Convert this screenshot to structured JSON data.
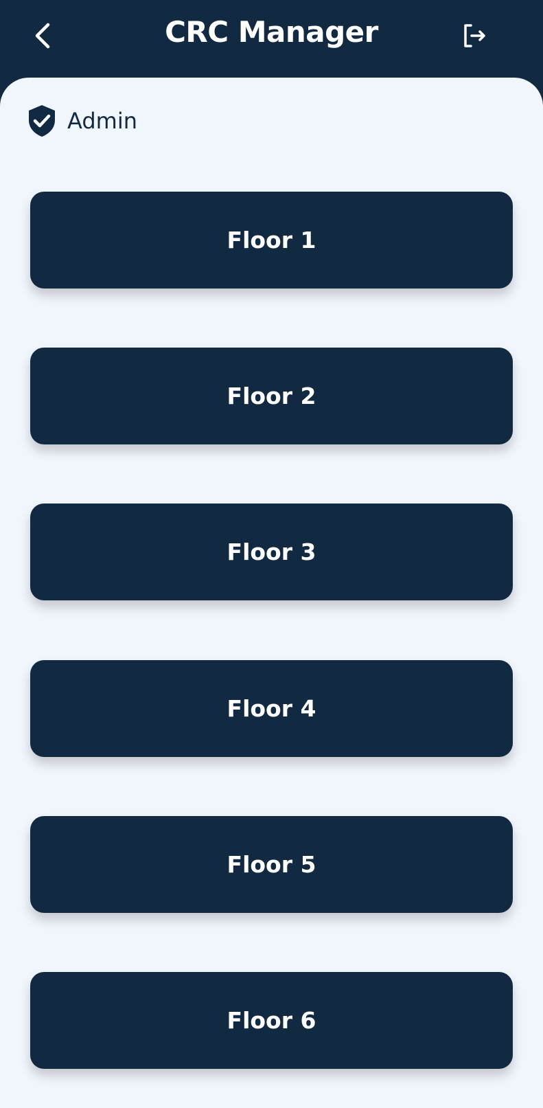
{
  "header": {
    "title": "CRC Manager",
    "back_icon": "chevron-left-icon",
    "logout_icon": "logout-icon"
  },
  "user": {
    "role": "Admin",
    "icon": "shield-check-icon"
  },
  "floors": [
    {
      "label": "Floor 1"
    },
    {
      "label": "Floor 2"
    },
    {
      "label": "Floor 3"
    },
    {
      "label": "Floor 4"
    },
    {
      "label": "Floor 5"
    },
    {
      "label": "Floor 6"
    }
  ],
  "colors": {
    "primary": "#112A42",
    "background": "#F1F5FC",
    "text_on_primary": "#FFFFFF"
  }
}
